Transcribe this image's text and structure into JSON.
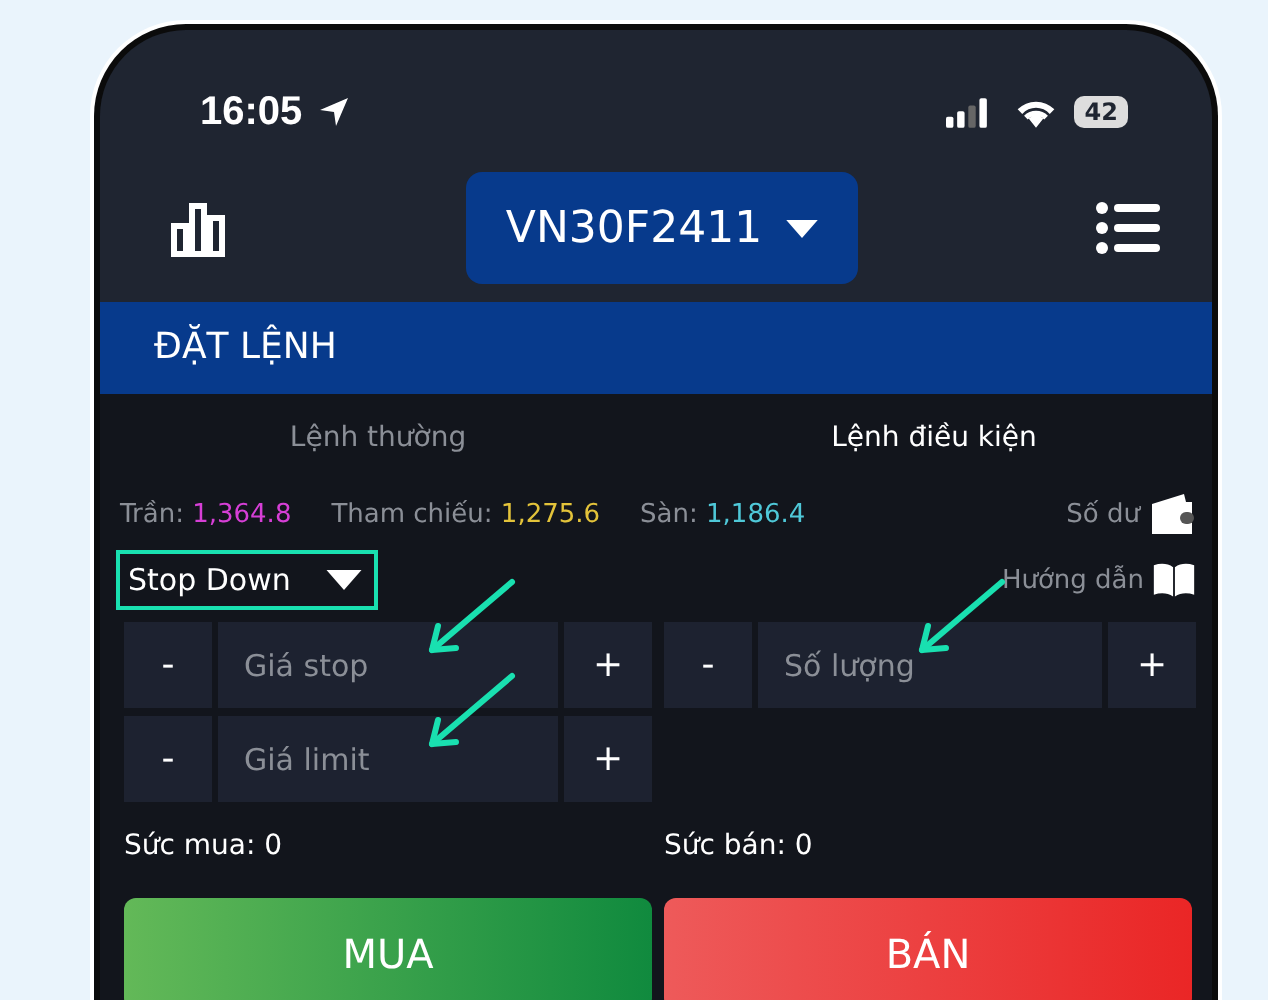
{
  "status_bar": {
    "time": "16:05",
    "battery": "42"
  },
  "header": {
    "symbol": "VN30F2411"
  },
  "section_title": "ĐẶT LỆNH",
  "tabs": [
    {
      "label": "Lệnh thường",
      "selected": false
    },
    {
      "label": "Lệnh điều kiện",
      "selected": true
    }
  ],
  "prices": [
    {
      "label": "Trần:",
      "value": "1,364.8",
      "color": "#d63fd6"
    },
    {
      "label": "Tham chiếu:",
      "value": "1,275.6",
      "color": "#e3c33a"
    },
    {
      "label": "Sàn:",
      "value": "1,186.4",
      "color": "#4fc8d8"
    }
  ],
  "balance_label": "Số dư",
  "order_type": {
    "value": "Stop Down",
    "highlighted": true
  },
  "guide_label": "Hướng dẫn",
  "fields": [
    {
      "minus": "-",
      "placeholder": "Giá stop",
      "plus": "+",
      "annotated": true
    },
    {
      "minus": "-",
      "placeholder": "Số lượng",
      "plus": "+",
      "annotated": true
    },
    {
      "minus": "-",
      "placeholder": "Giá limit",
      "plus": "+",
      "annotated": true
    }
  ],
  "power": [
    {
      "label": "Sức mua:",
      "value": "0"
    },
    {
      "label": "Sức bán:",
      "value": "0"
    }
  ],
  "actions": [
    {
      "label": "MUA",
      "kind": "buy"
    },
    {
      "label": "BÁN",
      "kind": "sell"
    }
  ]
}
